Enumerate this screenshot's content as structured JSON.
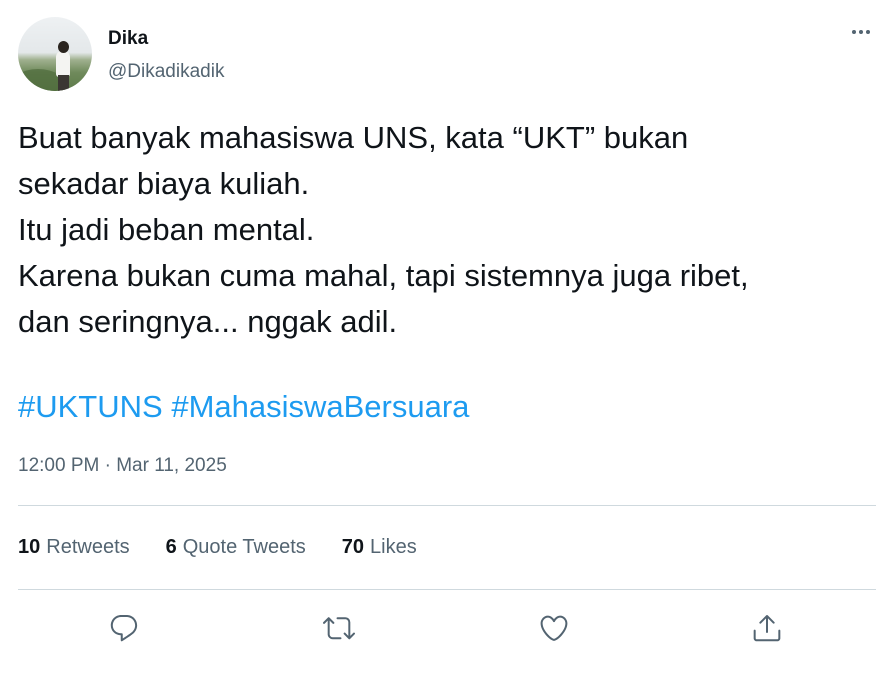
{
  "author": {
    "display_name": "Dika",
    "handle": "@Dikadikadik"
  },
  "tweet": {
    "lines": [
      "Buat banyak mahasiswa UNS, kata “UKT” bukan",
      "sekadar biaya kuliah.",
      "Itu jadi beban mental.",
      "Karena bukan cuma mahal, tapi sistemnya juga ribet,",
      "dan seringnya... nggak adil."
    ],
    "hashtags": [
      "#UKTUNS",
      "#MahasiswaBersuara"
    ],
    "timestamp": "12:00 PM · Mar 11, 2025"
  },
  "stats": {
    "retweets": {
      "count": "10",
      "label": "Retweets"
    },
    "quotes": {
      "count": "6",
      "label": "Quote Tweets"
    },
    "likes": {
      "count": "70",
      "label": "Likes"
    }
  },
  "colors": {
    "hashtag": "#1d9bf0",
    "secondary_text": "#536471",
    "divider": "#cfd9de"
  },
  "icons": {
    "more": "more-dots-icon",
    "reply": "reply-icon",
    "retweet": "retweet-icon",
    "like": "heart-icon",
    "share": "share-icon"
  }
}
